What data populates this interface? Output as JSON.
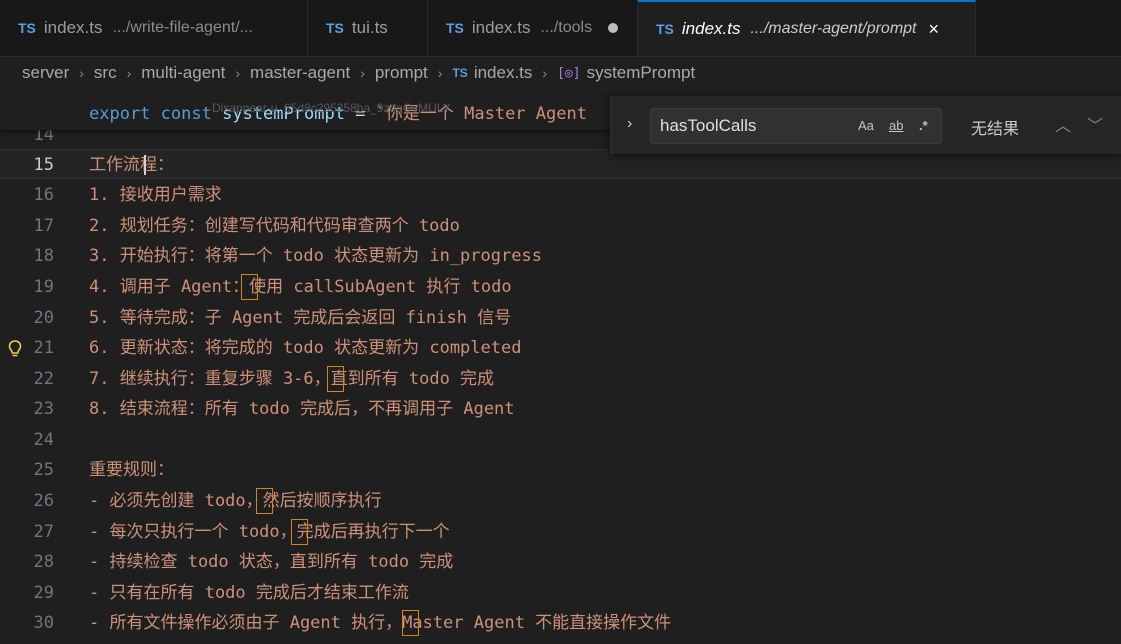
{
  "tabs": [
    {
      "name": "index.ts",
      "path": ".../write-file-agent/...",
      "active": false
    },
    {
      "name": "tui.ts",
      "path": "",
      "active": false
    },
    {
      "name": "index.ts",
      "path": ".../tools",
      "active": false,
      "modified": true
    },
    {
      "name": "index.ts",
      "path": ".../master-agent/prompt",
      "active": true
    }
  ],
  "tab_lang_label": "TS",
  "close_glyph": "×",
  "breadcrumb": [
    "server",
    "src",
    "multi-agent",
    "master-agent",
    "prompt",
    "index.ts",
    "systemPrompt"
  ],
  "breadcrumb_sep": "›",
  "breadcrumb_symbol_icon": "[◎]",
  "sticky": {
    "keyword_export": "export",
    "keyword_const": "const",
    "identifier": "systemPrompt",
    "operator": " = ",
    "string": "`你是一个 Master Agent"
  },
  "ghost_text": "Disappear-u_65d8c295258ba_9zdgOvMULY",
  "find": {
    "term": "hasToolCalls",
    "match_case": "Aa",
    "whole_word": "ab",
    "regex": ".*",
    "result": "无结果",
    "chevron": "›",
    "prev": "︿",
    "next": "﹀"
  },
  "lines": [
    {
      "n": "14",
      "text": ""
    },
    {
      "n": "15",
      "text": "工作流程："
    },
    {
      "n": "16",
      "text": "1. 接收用户需求"
    },
    {
      "n": "17",
      "text": "2. 规划任务：创建写代码和代码审查两个 todo"
    },
    {
      "n": "18",
      "text": "3. 开始执行：将第一个 todo 状态更新为 in_progress"
    },
    {
      "n": "19",
      "text": "4. 调用子 Agent：使用 callSubAgent 执行 todo"
    },
    {
      "n": "20",
      "text": "5. 等待完成：子 Agent 完成后会返回 finish 信号"
    },
    {
      "n": "21",
      "text": "6. 更新状态：将完成的 todo 状态更新为 completed"
    },
    {
      "n": "22",
      "text": "7. 继续执行：重复步骤 3-6，直到所有 todo 完成"
    },
    {
      "n": "23",
      "text": "8. 结束流程：所有 todo 完成后，不再调用子 Agent"
    },
    {
      "n": "24",
      "text": ""
    },
    {
      "n": "25",
      "text": "重要规则："
    },
    {
      "n": "26",
      "text": "- 必须先创建 todo，然后按顺序执行"
    },
    {
      "n": "27",
      "text": "- 每次只执行一个 todo，完成后再执行下一个"
    },
    {
      "n": "28",
      "text": "- 持续检查 todo 状态，直到所有 todo 完成"
    },
    {
      "n": "29",
      "text": "- 只有在所有 todo 完成后才结束工作流"
    },
    {
      "n": "30",
      "text": "- 所有文件操作必须由子 Agent 执行，Master Agent 不能直接操作文件"
    }
  ],
  "bulb_icon": "lightbulb-icon"
}
